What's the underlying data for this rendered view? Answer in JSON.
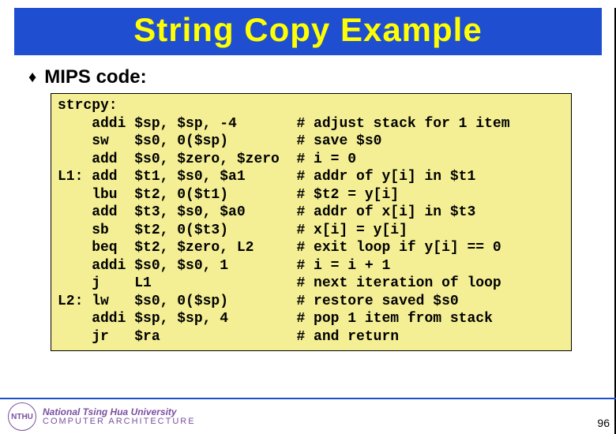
{
  "title": "String Copy Example",
  "subhead": "MIPS code:",
  "bullet_glyph": "♦",
  "code": "strcpy:\n    addi $sp, $sp, -4       # adjust stack for 1 item\n    sw   $s0, 0($sp)        # save $s0\n    add  $s0, $zero, $zero  # i = 0\nL1: add  $t1, $s0, $a1      # addr of y[i] in $t1\n    lbu  $t2, 0($t1)        # $t2 = y[i]\n    add  $t3, $s0, $a0      # addr of x[i] in $t3\n    sb   $t2, 0($t3)        # x[i] = y[i]\n    beq  $t2, $zero, L2     # exit loop if y[i] == 0\n    addi $s0, $s0, 1        # i = i + 1\n    j    L1                 # next iteration of loop\nL2: lw   $s0, 0($sp)        # restore saved $s0\n    addi $sp, $sp, 4        # pop 1 item from stack\n    jr   $ra                # and return",
  "footer": {
    "uni_name": "National Tsing Hua University",
    "uni_sub": "COMPUTER   ARCHITECTURE",
    "logo_abbrev": "NTHU"
  },
  "page_number": "96"
}
